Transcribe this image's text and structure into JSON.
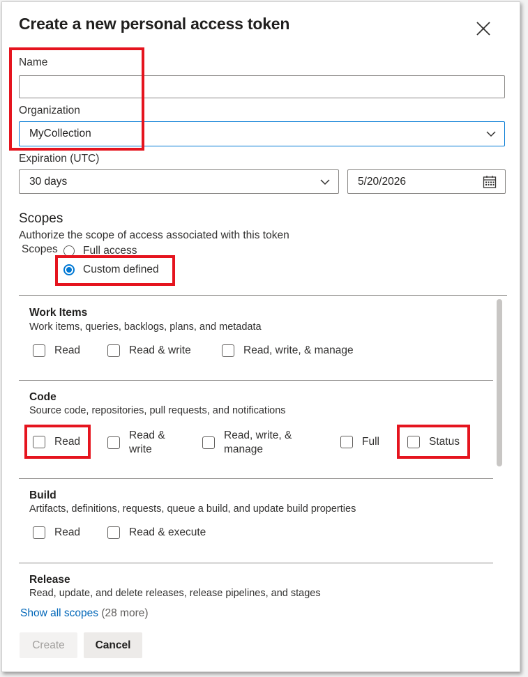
{
  "dialog": {
    "title": "Create a new personal access token"
  },
  "form": {
    "name_label": "Name",
    "name_value": "",
    "organization_label": "Organization",
    "organization_value": "MyCollection",
    "expiration_label": "Expiration (UTC)",
    "expiration_value": "30 days",
    "expiration_date": "5/20/2026"
  },
  "scopes": {
    "heading": "Scopes",
    "description": "Authorize the scope of access associated with this token",
    "label": "Scopes",
    "full_access": "Full access",
    "custom_defined": "Custom defined",
    "selected": "Custom defined",
    "sections": [
      {
        "title": "Work Items",
        "description": "Work items, queries, backlogs, plans, and metadata",
        "options": [
          "Read",
          "Read & write",
          "Read, write, & manage"
        ]
      },
      {
        "title": "Code",
        "description": "Source code, repositories, pull requests, and notifications",
        "options": [
          "Read",
          "Read &",
          "write",
          "Read, write, &",
          "manage",
          "Full",
          "Status"
        ]
      },
      {
        "title": "Build",
        "description": "Artifacts, definitions, requests, queue a build, and update build properties",
        "options": [
          "Read",
          "Read & execute"
        ]
      },
      {
        "title": "Release",
        "description": "Read, update, and delete releases, release pipelines, and stages"
      }
    ],
    "show_all_link": "Show all scopes",
    "show_all_count": "(28 more)"
  },
  "buttons": {
    "create": "Create",
    "cancel": "Cancel"
  },
  "colors": {
    "accent": "#0078d4",
    "highlight": "#e5141e",
    "link": "#0066b8"
  },
  "icons": {
    "close": "close-icon",
    "dropdown": "chevron-down-icon",
    "calendar": "calendar-icon"
  }
}
